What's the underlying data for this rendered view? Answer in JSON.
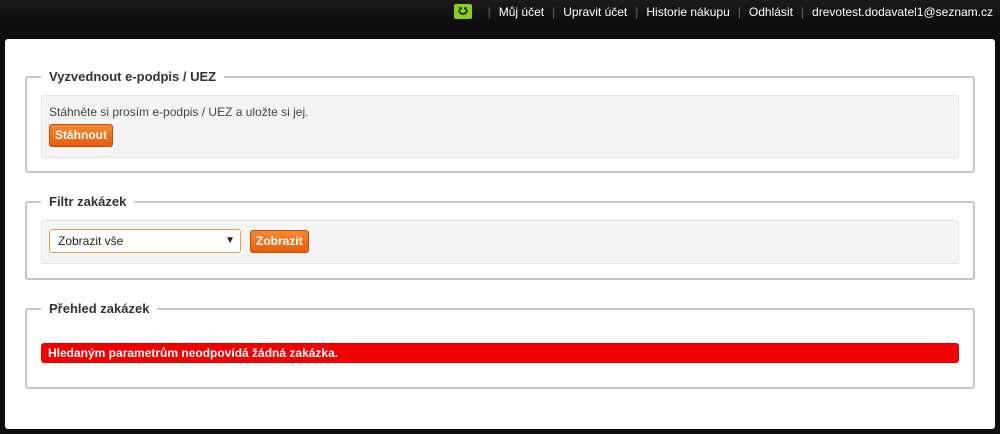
{
  "topnav": {
    "items": [
      "Můj účet",
      "Upravit účet",
      "Historie nákupu",
      "Odhlásit"
    ],
    "user_email": "drevotest.dodavatel1@seznam.cz"
  },
  "signature_section": {
    "legend": "Vyzvednout e-podpis / UEZ",
    "description": "Stáhněte si prosím e-podpis / UEZ a uložte si jej.",
    "download_button": "Stáhnout"
  },
  "filter_section": {
    "legend": "Filtr zakázek",
    "select_value": "Zobrazit vše",
    "show_button": "Zobrazit"
  },
  "overview_section": {
    "legend": "Přehled zakázek",
    "empty_message": "Hledaným parametrům neodpovídá žádná zakázka."
  },
  "colors": {
    "accent_button": "#e85c0c",
    "alert": "#f00000",
    "smiley": "#8bcf1c"
  }
}
